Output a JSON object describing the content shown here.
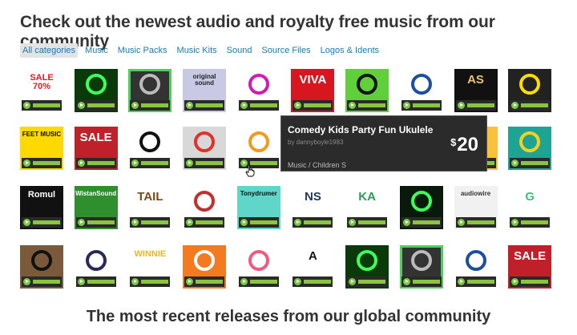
{
  "heading": "Check out the newest audio and royalty free music from our community",
  "categories": [
    {
      "label": "All categories",
      "active": true
    },
    {
      "label": "Music"
    },
    {
      "label": "Music Packs"
    },
    {
      "label": "Music Kits"
    },
    {
      "label": "Sound"
    },
    {
      "label": "Source Files"
    },
    {
      "label": "Logos & Idents"
    }
  ],
  "rows": [
    [
      {
        "bg": "#ffffff",
        "fg": "#e01b24",
        "text": "SALE 70%"
      },
      {
        "bg": "#0a3a0a",
        "fg": "#3dff5a",
        "text": ""
      },
      {
        "bg": "#333333",
        "fg": "#bbbbbb",
        "text": "",
        "sel": true
      },
      {
        "bg": "#c9c9e6",
        "fg": "#222",
        "text": "original sound"
      },
      {
        "bg": "#ffffff",
        "fg": "#cc1fb0",
        "text": ""
      },
      {
        "bg": "#d7161f",
        "fg": "#ffffff",
        "text": "VIVA"
      },
      {
        "bg": "#5fcf3a",
        "fg": "#111",
        "text": ""
      },
      {
        "bg": "#ffffff",
        "fg": "#1c4fa0",
        "text": ""
      },
      {
        "bg": "#111111",
        "fg": "#e8c470",
        "text": "AS"
      },
      {
        "bg": "#222222",
        "fg": "#ffdd00",
        "text": ""
      }
    ],
    [
      {
        "bg": "#ffd900",
        "fg": "#111",
        "text": "FEET MUSIC"
      },
      {
        "bg": "#c0202a",
        "fg": "#ffffff",
        "text": "SALE"
      },
      {
        "bg": "#ffffff",
        "fg": "#111",
        "text": ""
      },
      {
        "bg": "#d8d8d8",
        "fg": "#e0322a",
        "text": ""
      },
      {
        "bg": "#ffffff",
        "fg": "#f39a1d",
        "text": ""
      },
      {
        "bg": "#1d6a2a",
        "fg": "#fff",
        "text": "",
        "hidden": true
      },
      {
        "bg": "#ffffff",
        "fg": "#333",
        "text": "",
        "hidden": true
      },
      {
        "bg": "#ffffff",
        "fg": "#333",
        "text": "",
        "hidden": true
      },
      {
        "bg": "#f7c23a",
        "fg": "#222",
        "text": ""
      },
      {
        "bg": "#1fa395",
        "fg": "#f4d21b",
        "text": ""
      }
    ],
    [
      {
        "bg": "#111111",
        "fg": "#ffffff",
        "text": "Romul"
      },
      {
        "bg": "#2f8f2f",
        "fg": "#ffffff",
        "text": "WistanSound"
      },
      {
        "bg": "#ffffff",
        "fg": "#7a4a1a",
        "text": "TAIL"
      },
      {
        "bg": "#ffffff",
        "fg": "#c03030",
        "text": ""
      },
      {
        "bg": "#5fd6c9",
        "fg": "#111",
        "text": "Tonydrumer"
      },
      {
        "bg": "#ffffff",
        "fg": "#1e3a5a",
        "text": "NS"
      },
      {
        "bg": "#ffffff",
        "fg": "#2a9b57",
        "text": "KA"
      },
      {
        "bg": "#0a1a0a",
        "fg": "#3dff5a",
        "text": ""
      },
      {
        "bg": "#f1f1f1",
        "fg": "#333",
        "text": "audiowire"
      },
      {
        "bg": "#ffffff",
        "fg": "#3fbf7a",
        "text": "G"
      }
    ],
    [
      {
        "bg": "#7a5a3a",
        "fg": "#111",
        "text": ""
      },
      {
        "bg": "#ffffff",
        "fg": "#2a2a5a",
        "text": ""
      },
      {
        "bg": "#ffffff",
        "fg": "#e8b821",
        "text": "WINNIE"
      },
      {
        "bg": "#f47a1f",
        "fg": "#ffffff",
        "text": ""
      },
      {
        "bg": "#ffffff",
        "fg": "#f15a80",
        "text": ""
      },
      {
        "bg": "#ffffff",
        "fg": "#111",
        "text": "A"
      },
      {
        "bg": "#0a3a0a",
        "fg": "#3dff5a",
        "text": ""
      },
      {
        "bg": "#333333",
        "fg": "#bbbbbb",
        "text": "",
        "sel": true
      },
      {
        "bg": "#ffffff",
        "fg": "#1c4fa0",
        "text": ""
      },
      {
        "bg": "#c0202a",
        "fg": "#ffffff",
        "text": "SALE"
      }
    ]
  ],
  "popup": {
    "title": "Comedy Kids Party Fun Ukulele",
    "author": "by dannyboyle1983",
    "category": "Music / Children S",
    "currency": "$",
    "price": "20"
  },
  "subheading": "The most recent releases from our global community"
}
